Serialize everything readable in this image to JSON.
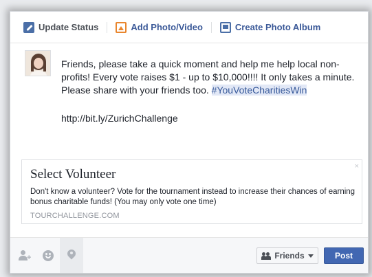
{
  "composer": {
    "tabs": [
      {
        "label": "Update Status",
        "icon": "pencil-icon"
      },
      {
        "label": "Add Photo/Video",
        "icon": "photo-icon"
      },
      {
        "label": "Create Photo Album",
        "icon": "album-icon"
      }
    ],
    "text": {
      "before": "Friends, please take a quick moment and help me help local non-profits! Every vote raises $1 - up to $10,000!!!! It only takes a minute. Please share with your friends too. ",
      "hashtag": "#YouVoteCharitiesWin",
      "link": "http://bit.ly/ZurichChallenge"
    }
  },
  "preview": {
    "title": "Select Volunteer",
    "description": "Don't know a volunteer? Vote for the tournament instead to increase their chances of earning bonus charitable funds! (You may only vote one time)",
    "domain": "TOURCHALLENGE.COM",
    "close": "×"
  },
  "footer": {
    "audience_label": "Friends",
    "post_label": "Post"
  },
  "colors": {
    "link_blue": "#3b5998",
    "post_button": "#4267b2",
    "photo_orange": "#e9862e"
  }
}
